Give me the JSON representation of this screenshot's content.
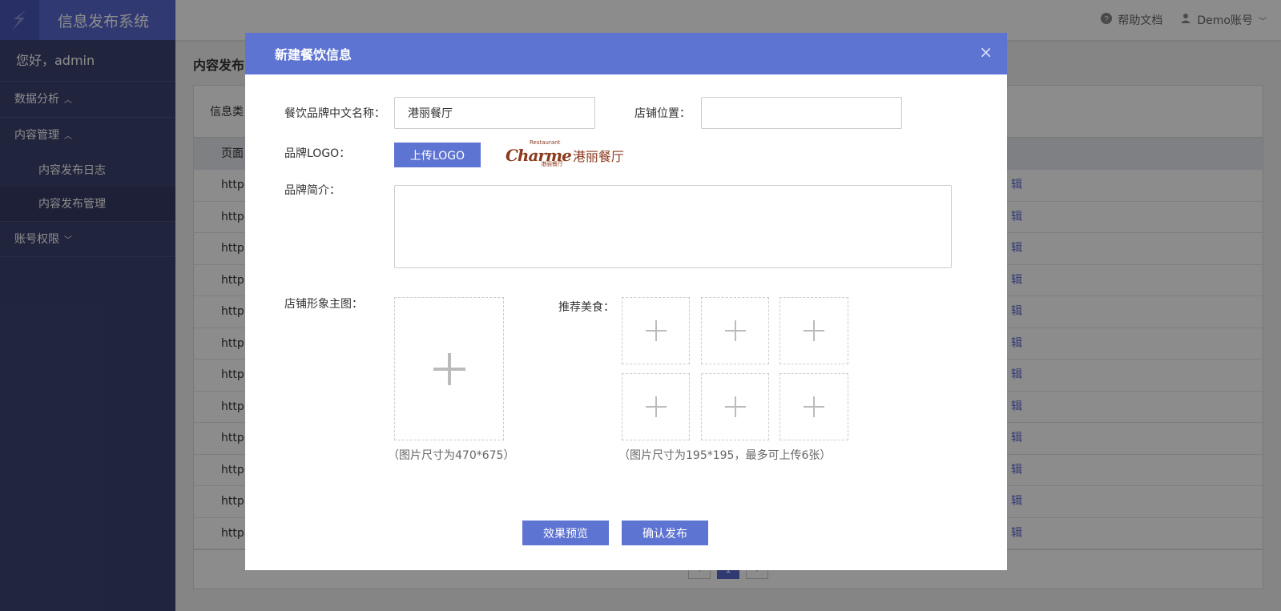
{
  "app": {
    "title": "信息发布系统",
    "greeting": "您好，admin",
    "accent_color": "#5e74d2"
  },
  "sidebar": {
    "items": [
      {
        "label": "数据分析",
        "caret": "^"
      },
      {
        "label": "内容管理",
        "caret": "^"
      },
      {
        "label": "内容发布日志"
      },
      {
        "label": "内容发布管理"
      },
      {
        "label": "账号权限",
        "caret": "⌄"
      }
    ]
  },
  "topbar": {
    "help": "帮助文档",
    "account": "Demo账号"
  },
  "background": {
    "page_title": "内容发布",
    "filter_label": "信息类",
    "column_header": "页面",
    "row_text": "http:/",
    "row_action": "辑",
    "pager_current": "1"
  },
  "modal": {
    "title": "新建餐饮信息",
    "close": "×",
    "brand_name_label": "餐饮品牌中文名称：",
    "brand_name_value": "港丽餐厅",
    "location_label": "店铺位置：",
    "location_value": "",
    "logo_label": "品牌LOGO：",
    "upload_logo": "上传LOGO",
    "logo_preview": {
      "script": "Charme",
      "small_top": "Restaurant",
      "cn": "港丽餐厅",
      "small_bottom": "港丽餐厅"
    },
    "intro_label": "品牌简介：",
    "intro_value": "",
    "main_image_label": "店铺形象主图：",
    "main_image_hint": "（图片尺寸为470*675）",
    "food_label": "推荐美食：",
    "food_hint": "（图片尺寸为195*195，最多可上传6张）",
    "preview_button": "效果预览",
    "publish_button": "确认发布"
  }
}
